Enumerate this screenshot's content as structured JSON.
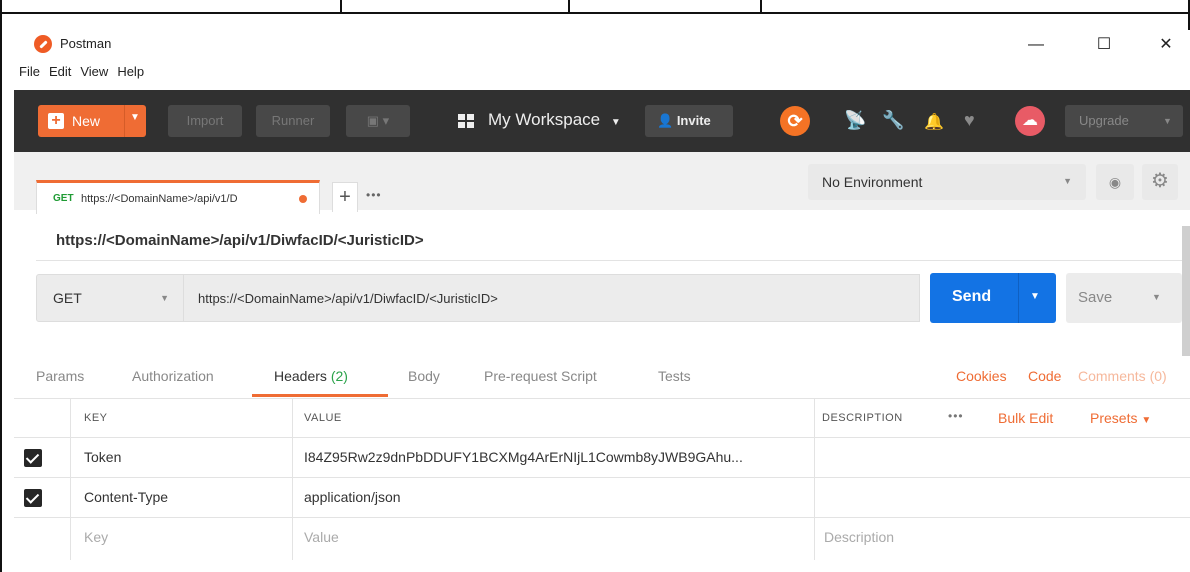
{
  "window": {
    "title": "Postman",
    "controls": {
      "minimize": "—",
      "maximize": "☐",
      "close": "✕"
    }
  },
  "menu": [
    "File",
    "Edit",
    "View",
    "Help"
  ],
  "toolbar": {
    "new_label": "New",
    "import_label": "Import",
    "runner_label": "Runner",
    "workspace_label": "My Workspace",
    "invite_label": "Invite",
    "upgrade_label": "Upgrade",
    "accent": "#ef6c34"
  },
  "tab": {
    "method": "GET",
    "url": "https://<DomainName>/api/v1/D",
    "more": "•••"
  },
  "environment": {
    "selected": "No Environment"
  },
  "request": {
    "name": "https://<DomainName>/api/v1/DiwfacID/<JuristicID>",
    "method": "GET",
    "url": "https://<DomainName>/api/v1/DiwfacID/<JuristicID>",
    "send_label": "Send",
    "save_label": "Save",
    "send_color": "#1373e4"
  },
  "request_tabs": {
    "params": "Params",
    "authorization": "Authorization",
    "headers": "Headers",
    "headers_count": "(2)",
    "body": "Body",
    "prerequest": "Pre-request Script",
    "tests": "Tests",
    "cookies": "Cookies",
    "code": "Code",
    "comments": "Comments (0)"
  },
  "headers_table": {
    "columns": {
      "key": "KEY",
      "value": "VALUE",
      "description": "DESCRIPTION"
    },
    "more": "•••",
    "bulk_edit": "Bulk Edit",
    "presets": "Presets",
    "rows": [
      {
        "checked": true,
        "key": "Token",
        "value": "I84Z95Rw2z9dnPbDDUFY1BCXMg4ArErNIjL1Cowmb8yJWB9GAhu..."
      },
      {
        "checked": true,
        "key": "Content-Type",
        "value": "application/json"
      }
    ],
    "placeholders": {
      "key": "Key",
      "value": "Value",
      "description": "Description"
    }
  }
}
